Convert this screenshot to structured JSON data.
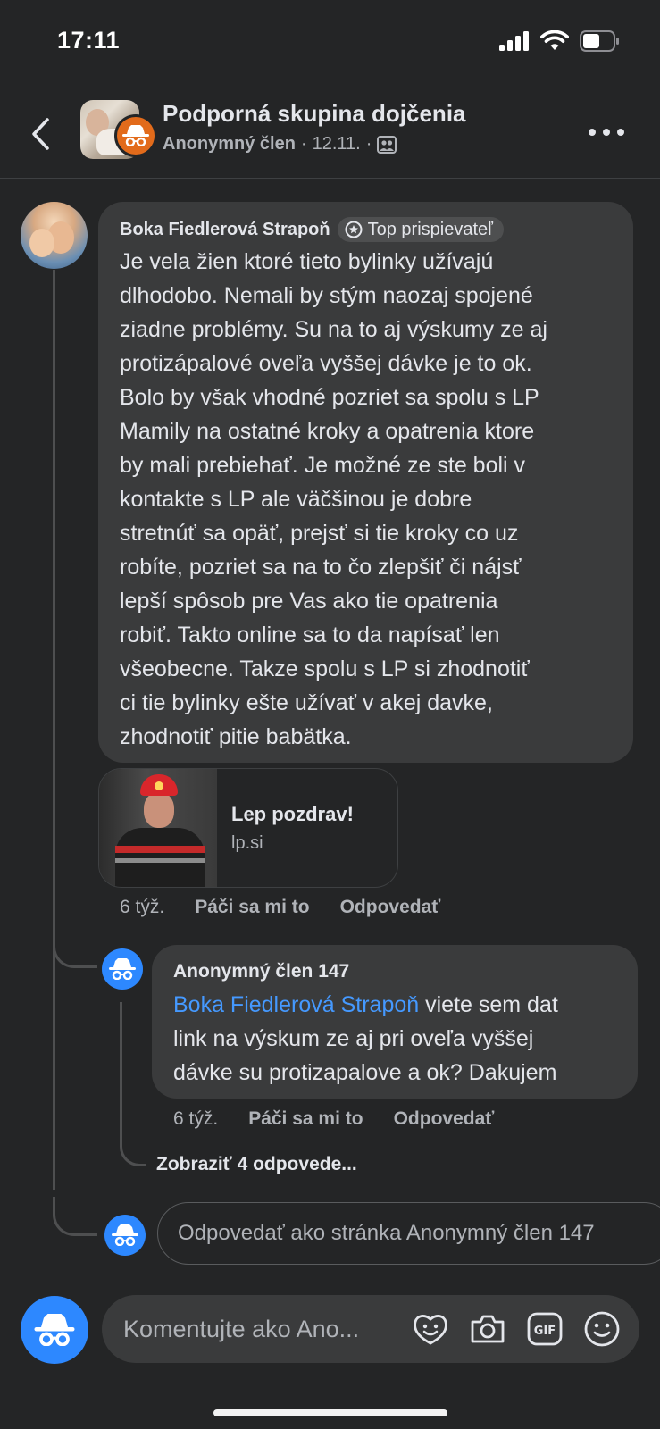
{
  "status_bar": {
    "time": "17:11"
  },
  "header": {
    "title": "Podporná skupina dojčenia",
    "sub_author": "Anonymný člen",
    "sub_date": "12.11.",
    "separator": "·"
  },
  "comment": {
    "author": "Boka Fiedlerová Strapoň",
    "badge": "Top prispievateľ",
    "lines": [
      "Je vela žien ktoré tieto bylinky užívajú",
      "dlhodobo. Nemali by stým naozaj spojené",
      "ziadne problémy. Su na to aj výskumy ze aj",
      "protizápalové oveľa vyššej dávke je to ok.",
      "Bolo by však vhodné pozriet sa spolu s LP",
      "Mamily na ostatné kroky a opatrenia ktore",
      "by mali prebiehať. Je možné ze ste boli v",
      "kontakte s LP ale väčšinou je dobre",
      "stretnúť sa opäť, prejsť si tie kroky co uz",
      "robíte, pozriet sa na to čo zlepšiť či nájsť",
      "lepší spôsob pre Vas ako tie opatrenia",
      "robiť. Takto online sa to da napísať len",
      "všeobecne. Takze spolu s LP si zhodnotiť",
      "ci tie bylinky ešte užívať v akej davke,",
      "zhodnotiť pitie babätka."
    ],
    "link": {
      "title": "Lep pozdrav!",
      "domain": "lp.si"
    },
    "time": "6 týž.",
    "like": "Páči sa mi to",
    "reply": "Odpovedať"
  },
  "reply": {
    "author": "Anonymný člen 147",
    "mention": "Boka Fiedlerová Strapoň",
    "line1_rest": " viete sem dat",
    "line2": "link na výskum ze aj pri oveľa vyššej",
    "line3": "dávke su protizapalove a ok? Dakujem",
    "time": "6 týž.",
    "like": "Páči sa mi to",
    "reply_action": "Odpovedať"
  },
  "view_replies": "Zobraziť 4 odpovede...",
  "reply_input": {
    "placeholder": "Odpovedať ako stránka Anonymný člen 147"
  },
  "composer": {
    "placeholder": "Komentujte ako Ano..."
  },
  "icons": {
    "back": "chevron-left-icon",
    "more": "more-horizontal-icon",
    "anon": "incognito-icon",
    "badge": "top-contributor-icon",
    "privacy": "members-icon",
    "avatar_frame": "avatar-frame-icon",
    "camera": "camera-icon",
    "gif": "gif-icon",
    "emoji": "emoji-icon"
  },
  "colors": {
    "background": "#242526",
    "bubble": "#3a3b3c",
    "mention": "#4599ff",
    "anon_avatar": "#2d88ff",
    "anon_badge": "#e26b1b"
  }
}
